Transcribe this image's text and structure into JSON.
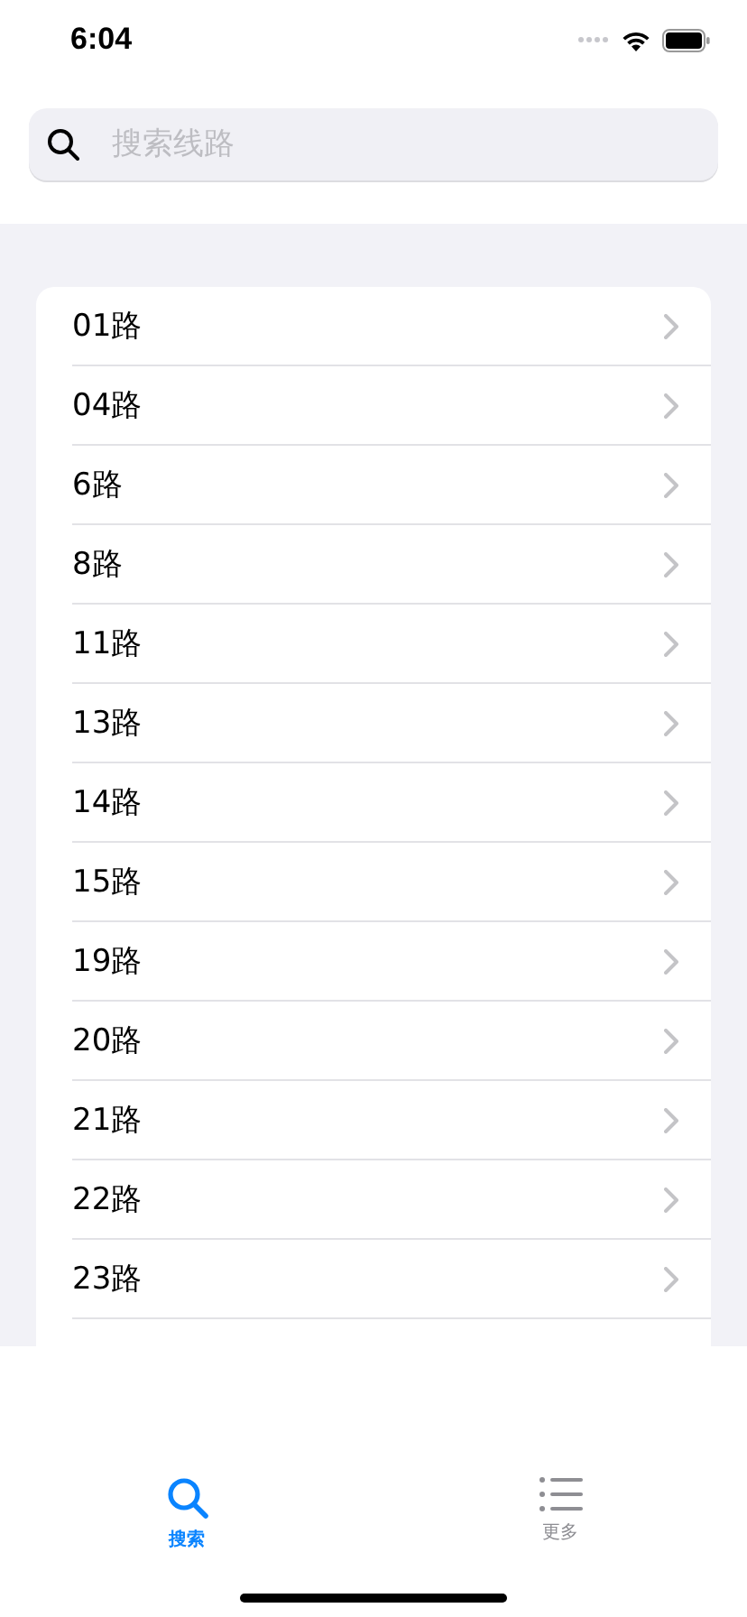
{
  "status_bar": {
    "time": "6:04"
  },
  "search": {
    "placeholder": "搜索线路"
  },
  "routes": [
    {
      "name": "01路"
    },
    {
      "name": "04路"
    },
    {
      "name": "6路"
    },
    {
      "name": "8路"
    },
    {
      "name": "11路"
    },
    {
      "name": "13路"
    },
    {
      "name": "14路"
    },
    {
      "name": "15路"
    },
    {
      "name": "19路"
    },
    {
      "name": "20路"
    },
    {
      "name": "21路"
    },
    {
      "name": "22路"
    },
    {
      "name": "23路"
    }
  ],
  "tabs": [
    {
      "label": "搜索",
      "kind": "search",
      "selected": true
    },
    {
      "label": "更多",
      "kind": "list",
      "selected": false
    }
  ]
}
